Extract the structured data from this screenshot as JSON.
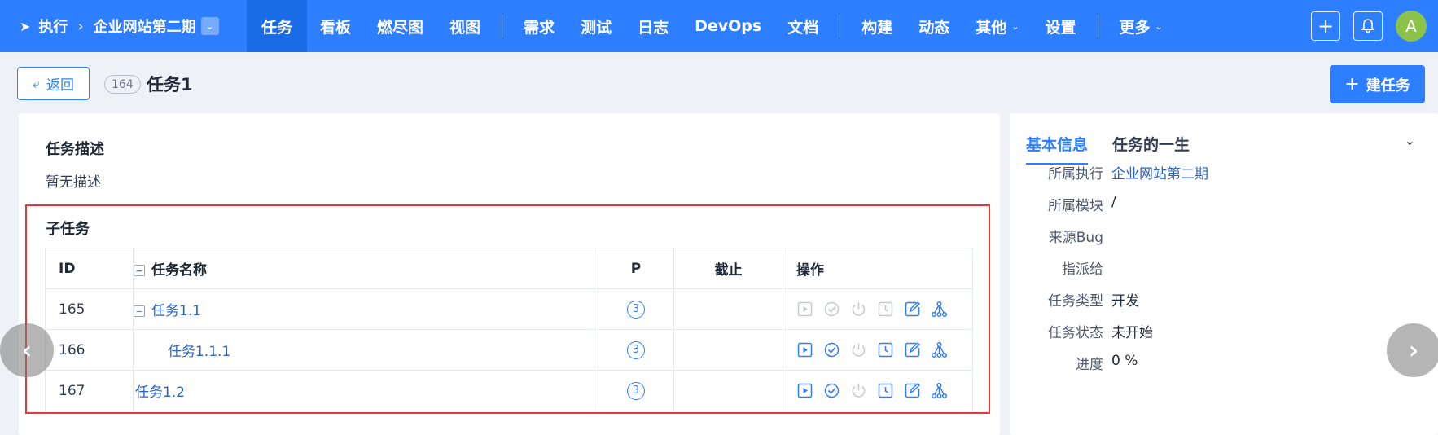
{
  "nav": {
    "breadcrumb_root": "执行",
    "breadcrumb_sep": "›",
    "project": "企业网站第二期",
    "items": [
      {
        "label": "任务"
      },
      {
        "label": "看板"
      },
      {
        "label": "燃尽图"
      },
      {
        "label": "视图"
      },
      {
        "label": "需求"
      },
      {
        "label": "测试"
      },
      {
        "label": "日志"
      },
      {
        "label": "DevOps"
      },
      {
        "label": "文档"
      },
      {
        "label": "构建"
      },
      {
        "label": "动态"
      },
      {
        "label": "其他"
      },
      {
        "label": "设置"
      },
      {
        "label": "更多"
      }
    ],
    "avatar_letter": "A",
    "add_glyph": "+"
  },
  "header": {
    "back_label": "返回",
    "task_id": "164",
    "task_title": "任务1",
    "create_label": "建任务"
  },
  "main": {
    "desc_title": "任务描述",
    "desc_text": "暂无描述",
    "subtask_title": "子任务",
    "columns": {
      "id": "ID",
      "name": "任务名称",
      "priority": "P",
      "deadline": "截止",
      "actions": "操作"
    },
    "rows": [
      {
        "id": "165",
        "name": "任务1.1",
        "priority": "3",
        "deadline": "",
        "collapsible": true,
        "indent": 0,
        "ops_enabled": [
          false,
          false,
          false,
          false,
          true,
          true
        ]
      },
      {
        "id": "166",
        "name": "任务1.1.1",
        "priority": "3",
        "deadline": "",
        "collapsible": false,
        "indent": 2,
        "ops_enabled": [
          true,
          true,
          false,
          true,
          true,
          true
        ]
      },
      {
        "id": "167",
        "name": "任务1.2",
        "priority": "3",
        "deadline": "",
        "collapsible": false,
        "indent": 0,
        "ops_enabled": [
          true,
          true,
          false,
          true,
          true,
          true
        ]
      }
    ],
    "op_icons": [
      "start-icon",
      "finish-icon",
      "close-icon",
      "record-effort-icon",
      "edit-icon",
      "batch-create-icon"
    ]
  },
  "side": {
    "tab_basic": "基本信息",
    "tab_life": "任务的一生",
    "fields": [
      {
        "label": "所属执行",
        "value": "企业网站第二期",
        "link": true
      },
      {
        "label": "所属模块",
        "value": "/",
        "link": false
      },
      {
        "label": "来源Bug",
        "value": "",
        "link": false
      },
      {
        "label": "指派给",
        "value": "",
        "link": false
      },
      {
        "label": "任务类型",
        "value": "开发",
        "link": false
      },
      {
        "label": "任务状态",
        "value": "未开始",
        "link": false
      },
      {
        "label": "进度",
        "value": "0 %",
        "link": false
      }
    ]
  },
  "colors": {
    "accent": "#2e7fff",
    "highlight_border": "#e53935"
  }
}
